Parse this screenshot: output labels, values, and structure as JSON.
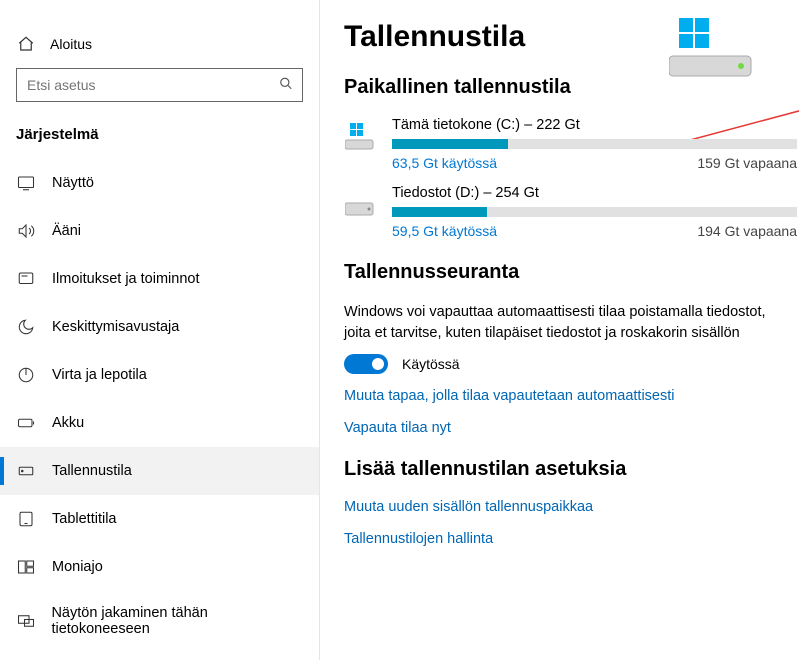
{
  "sidebar": {
    "home_label": "Aloitus",
    "search_placeholder": "Etsi asetus",
    "section": "Järjestelmä",
    "items": [
      {
        "label": "Näyttö"
      },
      {
        "label": "Ääni"
      },
      {
        "label": "Ilmoitukset ja toiminnot"
      },
      {
        "label": "Keskittymisavustaja"
      },
      {
        "label": "Virta ja lepotila"
      },
      {
        "label": "Akku"
      },
      {
        "label": "Tallennustila"
      },
      {
        "label": "Tablettitila"
      },
      {
        "label": "Moniajo"
      },
      {
        "label": "Näytön jakaminen tähän tietokoneeseen"
      }
    ]
  },
  "main": {
    "title": "Tallennustila",
    "local_storage_heading": "Paikallinen tallennustila",
    "drives": [
      {
        "title": "Tämä tietokone (C:) – 222 Gt",
        "used_label": "63,5 Gt käytössä",
        "free_label": "159 Gt vapaana",
        "used_gb": 63.5,
        "total_gb": 222
      },
      {
        "title": "Tiedostot (D:) – 254 Gt",
        "used_label": "59,5 Gt käytössä",
        "free_label": "194 Gt vapaana",
        "used_gb": 59.5,
        "total_gb": 254
      }
    ],
    "storage_sense_heading": "Tallennusseuranta",
    "storage_sense_desc": "Windows voi vapauttaa automaattisesti tilaa poistamalla tiedostot, joita et tarvitse, kuten tilapäiset tiedostot ja roskakorin sisällön",
    "toggle_label": "Käytössä",
    "link_change_auto": "Muuta tapaa, jolla tilaa vapautetaan automaattisesti",
    "link_free_now": "Vapauta tilaa nyt",
    "more_settings_heading": "Lisää tallennustilan asetuksia",
    "link_change_save_loc": "Muuta uuden sisällön tallennuspaikkaa",
    "link_manage_spaces": "Tallennustilojen hallinta"
  }
}
